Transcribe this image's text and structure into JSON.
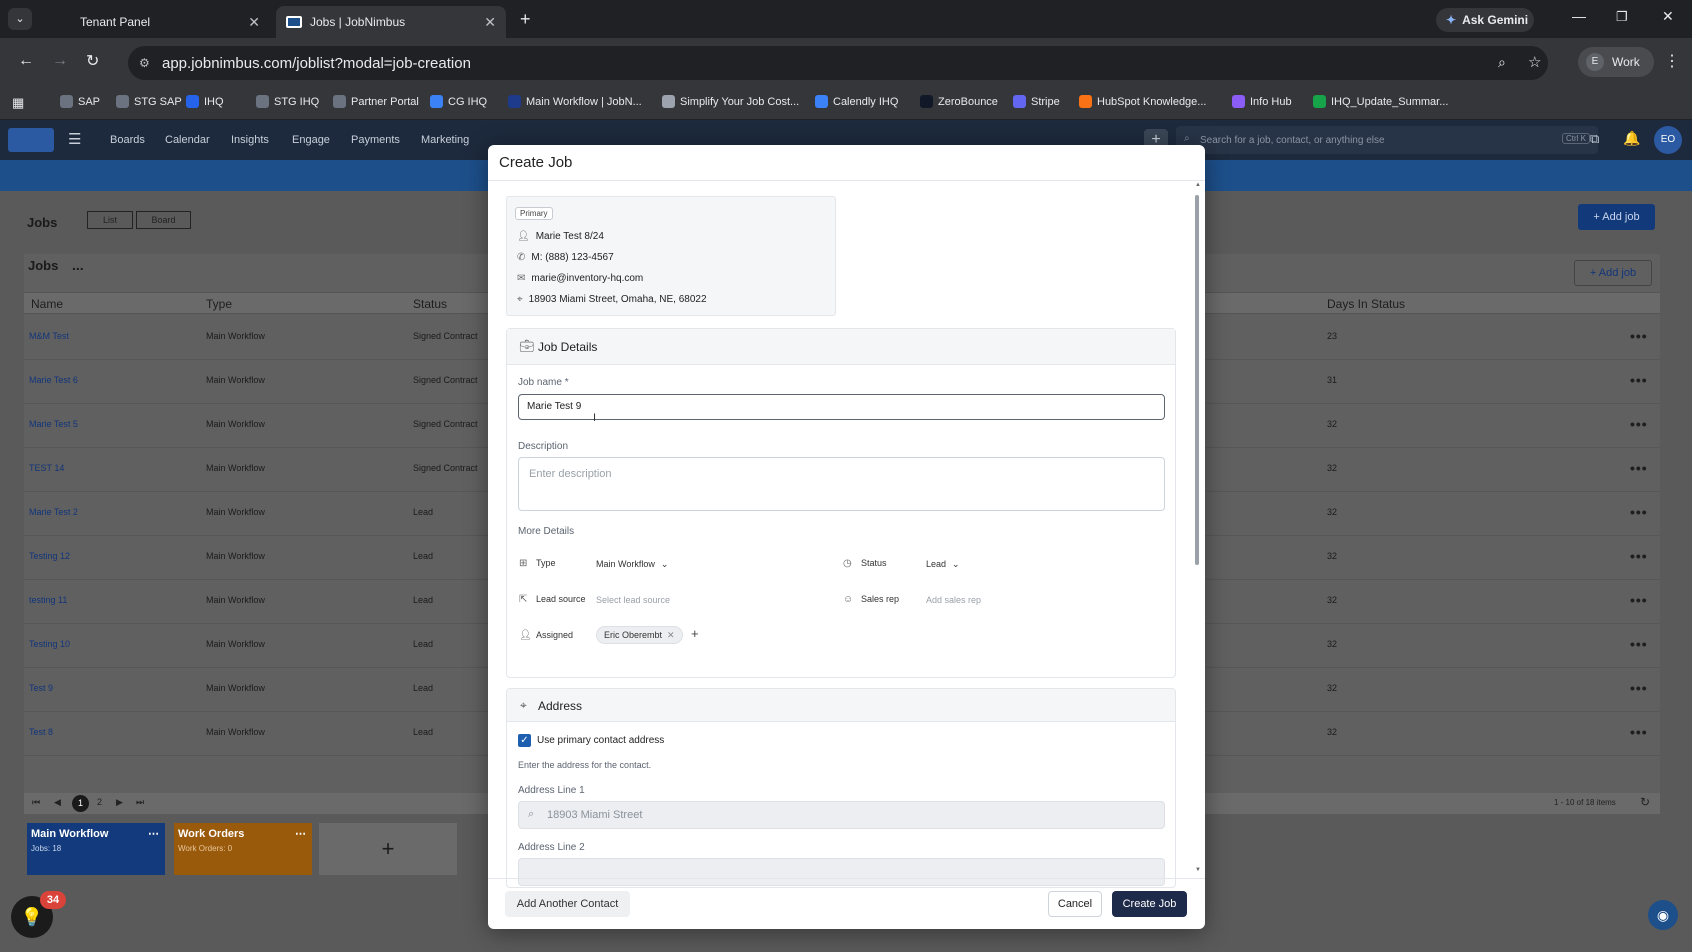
{
  "browser": {
    "tabs": [
      {
        "label": "Tenant Panel"
      },
      {
        "label": "Jobs | JobNimbus"
      }
    ],
    "url": "app.jobnimbus.com/joblist?modal=job-creation",
    "ask_gemini": "Ask Gemini",
    "profile_letter": "E",
    "profile_label": "Work"
  },
  "bookmarks": [
    {
      "label": "SAP",
      "color": "#6b7280"
    },
    {
      "label": "STG SAP",
      "color": "#6b7280"
    },
    {
      "label": "IHQ",
      "color": "#2563eb"
    },
    {
      "label": "STG IHQ",
      "color": "#6b7280"
    },
    {
      "label": "Partner Portal",
      "color": "#6b7280"
    },
    {
      "label": "CG IHQ",
      "color": "#3b82f6"
    },
    {
      "label": "Main Workflow | JobN...",
      "color": "#1e3a8a"
    },
    {
      "label": "Simplify Your Job Cost...",
      "color": "#9ca3af"
    },
    {
      "label": "Calendly IHQ",
      "color": "#3b82f6"
    },
    {
      "label": "ZeroBounce",
      "color": "#111827"
    },
    {
      "label": "Stripe",
      "color": "#6366f1"
    },
    {
      "label": "HubSpot Knowledge...",
      "color": "#f97316"
    },
    {
      "label": "Info Hub",
      "color": "#8b5cf6"
    },
    {
      "label": "IHQ_Update_Summar...",
      "color": "#16a34a"
    }
  ],
  "nav": {
    "items": [
      "Boards",
      "Calendar",
      "Insights",
      "Engage",
      "Payments",
      "Marketing"
    ],
    "search_placeholder": "Search for a job, contact, or anything else",
    "shortcut": "Ctrl K",
    "avatar": "EO"
  },
  "page": {
    "title": "Jobs",
    "view_list": "List",
    "view_board": "Board",
    "add_job": "+ Add job",
    "panel_title": "Jobs",
    "panel_more": "...",
    "add_job_small": "+ Add job",
    "columns": [
      "Name",
      "Type",
      "Status",
      "Days In Status"
    ],
    "rows": [
      {
        "name": "M&M Test",
        "type": "Main Workflow",
        "status": "Signed Contract",
        "days": "23"
      },
      {
        "name": "Marie Test 6",
        "type": "Main Workflow",
        "status": "Signed Contract",
        "days": "31"
      },
      {
        "name": "Marie Test 5",
        "type": "Main Workflow",
        "status": "Signed Contract",
        "days": "32"
      },
      {
        "name": "TEST 14",
        "type": "Main Workflow",
        "status": "Signed Contract",
        "days": "32"
      },
      {
        "name": "Marie Test 2",
        "type": "Main Workflow",
        "status": "Lead",
        "days": "32"
      },
      {
        "name": "Testing 12",
        "type": "Main Workflow",
        "status": "Lead",
        "days": "32"
      },
      {
        "name": "testing 11",
        "type": "Main Workflow",
        "status": "Lead",
        "days": "32"
      },
      {
        "name": "Testing 10",
        "type": "Main Workflow",
        "status": "Lead",
        "days": "32"
      },
      {
        "name": "Test 9",
        "type": "Main Workflow",
        "status": "Lead",
        "days": "32"
      },
      {
        "name": "Test 8",
        "type": "Main Workflow",
        "status": "Lead",
        "days": "32"
      }
    ],
    "pagination": {
      "page1": "1",
      "page2": "2",
      "summary": "1 - 10 of 18 items"
    },
    "workflows": [
      {
        "name": "Main Workflow",
        "count": "Jobs: 18",
        "color": "#133a7c"
      },
      {
        "name": "Work Orders",
        "count": "Work Orders: 0",
        "color": "#9a5a0c"
      }
    ],
    "help_badge": "34"
  },
  "modal": {
    "title": "Create Job",
    "contact": {
      "tag": "Primary",
      "name": "Marie Test 8/24",
      "phone": "M: (888) 123-4567",
      "email": "marie@inventory-hq.com",
      "address": "18903 Miami Street, Omaha, NE, 68022"
    },
    "job_details": {
      "heading": "Job Details",
      "job_name_label": "Job name *",
      "job_name_value": "Marie Test 9",
      "description_label": "Description",
      "description_placeholder": "Enter description",
      "more_details": "More Details",
      "type_label": "Type",
      "type_value": "Main Workflow",
      "status_label": "Status",
      "status_value": "Lead",
      "lead_source_label": "Lead source",
      "lead_source_placeholder": "Select lead source",
      "sales_rep_label": "Sales rep",
      "sales_rep_placeholder": "Add sales rep",
      "assigned_label": "Assigned",
      "assigned_chip": "Eric Oberembt"
    },
    "address": {
      "heading": "Address",
      "use_primary": "Use primary contact address",
      "use_primary_checked": true,
      "hint": "Enter the address for the contact.",
      "line1_label": "Address Line 1",
      "line1_value": "18903 Miami Street",
      "line2_label": "Address Line 2"
    },
    "footer": {
      "add_contact": "Add Another Contact",
      "cancel": "Cancel",
      "create": "Create Job"
    }
  }
}
